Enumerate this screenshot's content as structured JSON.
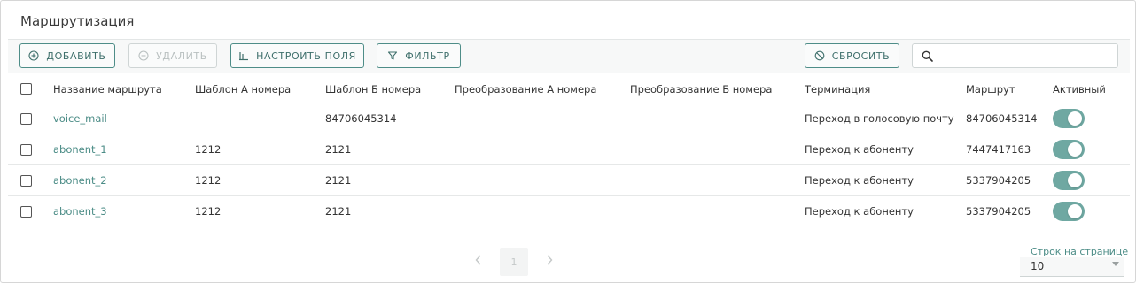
{
  "page": {
    "title": "Маршрутизация"
  },
  "toolbar": {
    "add_label": "ДОБАВИТЬ",
    "delete_label": "УДАЛИТЬ",
    "configure_label": "НАСТРОИТЬ ПОЛЯ",
    "filter_label": "ФИЛЬТР",
    "reset_label": "СБРОСИТЬ",
    "search_value": "",
    "search_placeholder": ""
  },
  "table": {
    "columns": [
      "Название маршрута",
      "Шаблон А номера",
      "Шаблон Б номера",
      "Преобразование А номера",
      "Преобразование Б номера",
      "Терминация",
      "Маршрут",
      "Активный"
    ],
    "rows": [
      {
        "name": "voice_mail",
        "a_template": "",
        "b_template": "84706045314",
        "a_transform": "",
        "b_transform": "",
        "termination": "Переход в голосовую почту",
        "route": "84706045314",
        "active": true
      },
      {
        "name": "abonent_1",
        "a_template": "1212",
        "b_template": "2121",
        "a_transform": "",
        "b_transform": "",
        "termination": "Переход к абоненту",
        "route": "7447417163",
        "active": true
      },
      {
        "name": "abonent_2",
        "a_template": "1212",
        "b_template": "2121",
        "a_transform": "",
        "b_transform": "",
        "termination": "Переход к абоненту",
        "route": "5337904205",
        "active": true
      },
      {
        "name": "abonent_3",
        "a_template": "1212",
        "b_template": "2121",
        "a_transform": "",
        "b_transform": "",
        "termination": "Переход к абоненту",
        "route": "5337904205",
        "active": true
      }
    ]
  },
  "pagination": {
    "current_page": "1",
    "prev_icon": "chevron-left-icon",
    "next_icon": "chevron-right-icon",
    "rows_per_page_label": "Строк на странице",
    "rows_per_page_value": "10"
  },
  "colors": {
    "accent": "#4e8d88",
    "toggle_on": "#6fa8a2",
    "link": "#4b8c86"
  }
}
